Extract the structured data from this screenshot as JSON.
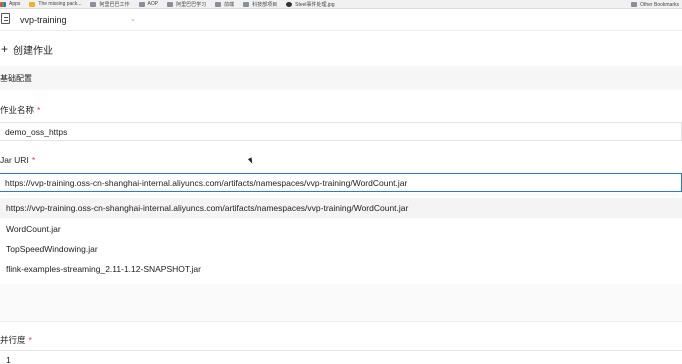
{
  "bookmarks": {
    "items": [
      {
        "label": "Apps",
        "icon": "apps-grid-icon"
      },
      {
        "label": "The missing pack...",
        "icon": "package-icon"
      },
      {
        "label": "阿里巴巴工作",
        "icon": "folder-icon"
      },
      {
        "label": "AOP",
        "icon": "folder-icon"
      },
      {
        "label": "阿里巴巴学习",
        "icon": "folder-icon"
      },
      {
        "label": "前端",
        "icon": "folder-icon"
      },
      {
        "label": "科技部项目",
        "icon": "folder-icon"
      },
      {
        "label": "Steel事件处理.jpg",
        "icon": "image-file-icon"
      }
    ],
    "other": "Other Bookmarks"
  },
  "project": {
    "name": "vvp-training"
  },
  "page": {
    "create_title": "创建作业",
    "section_title": "基础配置"
  },
  "form": {
    "job_name": {
      "label": "作业名称",
      "required_mark": "*",
      "value": "demo_oss_https"
    },
    "jar_uri": {
      "label": "Jar URI",
      "required_mark": "*",
      "value": "https://vvp-training.oss-cn-shanghai-internal.aliyuncs.com/artifacts/namespaces/vvp-training/WordCount.jar"
    },
    "parallelism": {
      "label": "并行度",
      "required_mark": "*",
      "value": "1"
    }
  },
  "dropdown": {
    "options": [
      "https://vvp-training.oss-cn-shanghai-internal.aliyuncs.com/artifacts/namespaces/vvp-training/WordCount.jar",
      "WordCount.jar",
      "TopSpeedWindowing.jar",
      "flink-examples-streaming_2.11-1.12-SNAPSHOT.jar"
    ]
  },
  "colors": {
    "accent": "#2a7bd8",
    "required": "#e23c39",
    "section_bg": "#f6f6f6"
  }
}
